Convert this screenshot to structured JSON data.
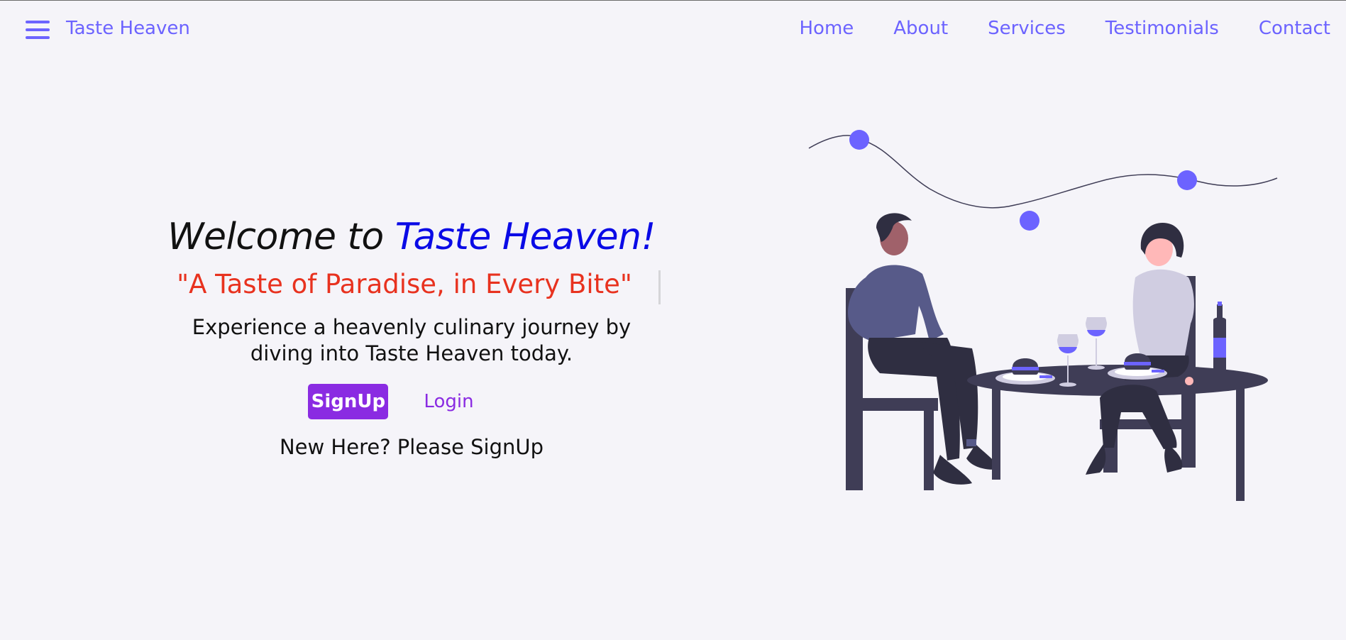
{
  "navbar": {
    "menu_icon": "hamburger-menu-icon",
    "brand": "Taste Heaven",
    "links": [
      "Home",
      "About",
      "Services",
      "Testimonials",
      "Contact"
    ]
  },
  "hero": {
    "welcome_prefix": "Welcome to",
    "welcome_brand": "Taste Heaven!",
    "tagline": "\"A Taste of Paradise, in Every Bite\"",
    "description_line1": "Experience a heavenly culinary journey by",
    "description_line2": "diving into Taste Heaven today.",
    "signup_label": "SignUp",
    "login_label": "Login",
    "hint": "New Here? Please SignUp"
  },
  "colors": {
    "accent": "#6c63ff",
    "brand_blue": "#0a0ae6",
    "tagline_red": "#e8321f",
    "button_purple": "#8a2be2",
    "background": "#f5f4f9",
    "illustration_dark": "#2f2e41"
  },
  "illustration": {
    "icon": "couple-dining-illustration"
  }
}
